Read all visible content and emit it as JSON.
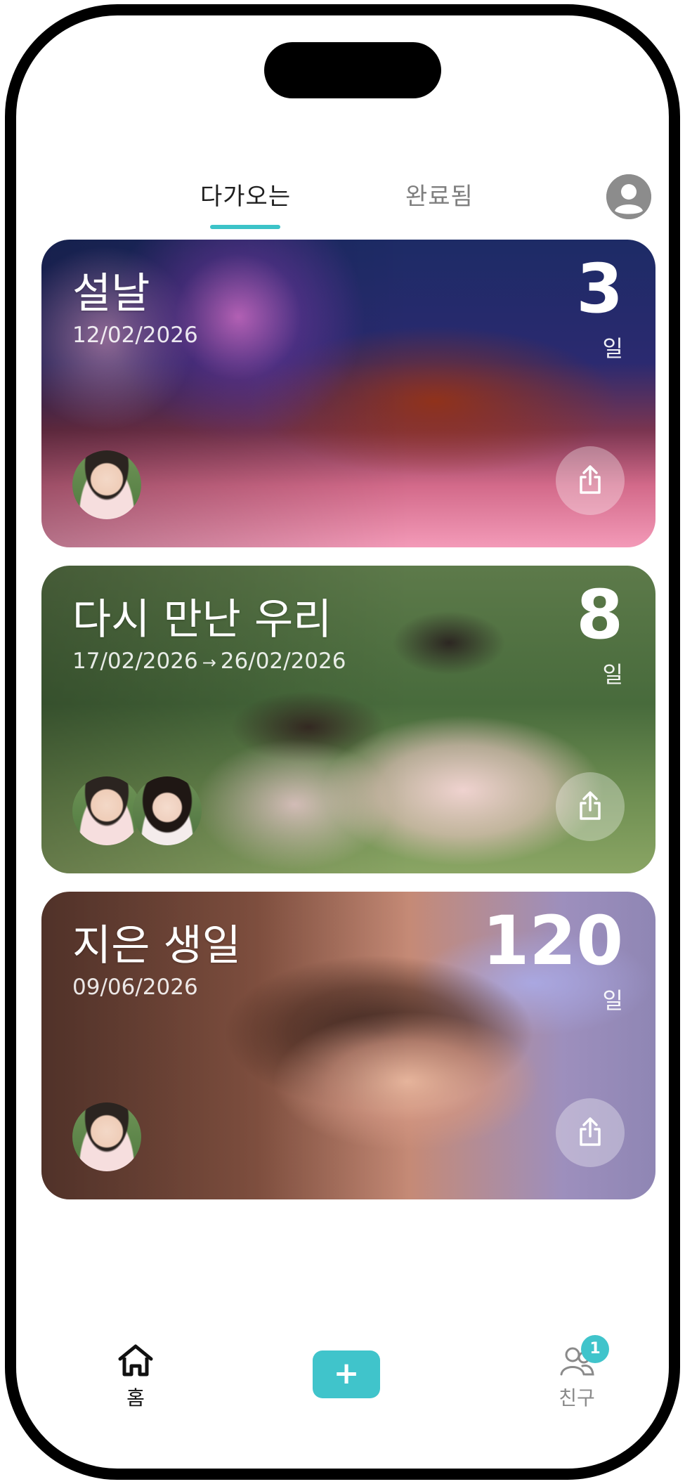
{
  "tabs": {
    "upcoming": "다가오는",
    "completed": "완료됨",
    "selected": "upcoming"
  },
  "cards": [
    {
      "title": "설날",
      "date": "12/02/2026",
      "days": "3",
      "unit": "일",
      "participants": 1
    },
    {
      "title": "다시 만난 우리",
      "date_start": "17/02/2026",
      "arrow": "→",
      "date_end": "26/02/2026",
      "days": "8",
      "unit": "일",
      "participants": 2
    },
    {
      "title": "지은 생일",
      "date": "09/06/2026",
      "days": "120",
      "unit": "일",
      "participants": 1
    }
  ],
  "tabbar": {
    "home_label": "홈",
    "add_symbol": "+",
    "friends_label": "친구",
    "friends_badge": "1"
  },
  "colors": {
    "accent": "#3cc3c8",
    "tab_active": "#1e1e1e",
    "tab_inactive": "#7f7f7f"
  }
}
